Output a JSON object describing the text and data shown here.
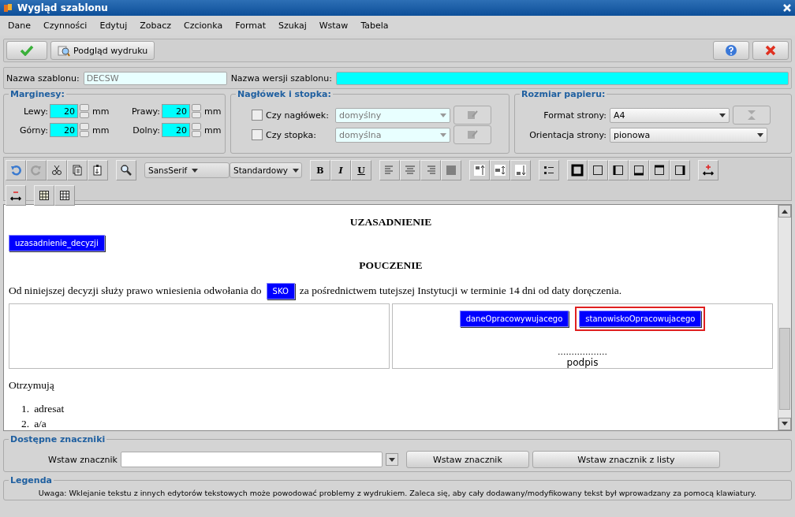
{
  "window": {
    "title": "Wygląd szablonu"
  },
  "menu": [
    "Dane",
    "Czynności",
    "Edytuj",
    "Zobacz",
    "Czcionka",
    "Format",
    "Szukaj",
    "Wstaw",
    "Tabela"
  ],
  "toolbar": {
    "preview_button": "Podgląd wydruku"
  },
  "name_row": {
    "template_label": "Nazwa szablonu:",
    "template_value": "DECSW",
    "version_label": "Nazwa wersji szablonu:"
  },
  "margins": {
    "title": "Marginesy:",
    "fields": [
      {
        "label": "Lewy:",
        "value": "20",
        "unit": "mm"
      },
      {
        "label": "Prawy:",
        "value": "20",
        "unit": "mm"
      },
      {
        "label": "Górny:",
        "value": "20",
        "unit": "mm"
      },
      {
        "label": "Dolny:",
        "value": "20",
        "unit": "mm"
      }
    ]
  },
  "header_footer": {
    "title": "Nagłówek i stopka:",
    "rows": [
      {
        "label": "Czy nagłówek:",
        "checked": false,
        "value": "domyślny"
      },
      {
        "label": "Czy stopka:",
        "checked": false,
        "value": "domyślna"
      }
    ]
  },
  "paper": {
    "title": "Rozmiar papieru:",
    "rows": [
      {
        "label": "Format strony:",
        "value": "A4"
      },
      {
        "label": "Orientacja strony:",
        "value": "pionowa"
      }
    ]
  },
  "editor_toolbar": [
    {
      "kind": "icon",
      "disabled": false
    },
    {
      "kind": "icon",
      "disabled": true
    },
    {
      "kind": "icon",
      "disabled": false
    },
    {
      "kind": "icon",
      "disabled": false
    },
    {
      "kind": "icon",
      "disabled": false
    },
    {
      "kind": "gap"
    },
    {
      "kind": "icon",
      "disabled": false
    },
    {
      "kind": "gap"
    },
    {
      "kind": "dropdown",
      "value": "SansSerif"
    },
    {
      "kind": "dropdown",
      "value": "Standardowy"
    },
    {
      "kind": "gap"
    },
    {
      "kind": "text",
      "label": "B"
    },
    {
      "kind": "text",
      "label": "I"
    },
    {
      "kind": "text",
      "label": "U"
    },
    {
      "kind": "gap"
    },
    {
      "kind": "icon",
      "disabled": false
    },
    {
      "kind": "icon",
      "disabled": false
    },
    {
      "kind": "icon",
      "disabled": false
    },
    {
      "kind": "icon",
      "disabled": false
    },
    {
      "kind": "gap"
    },
    {
      "kind": "icon",
      "disabled": false
    },
    {
      "kind": "icon",
      "disabled": false
    },
    {
      "kind": "icon",
      "disabled": false
    },
    {
      "kind": "gap"
    },
    {
      "kind": "icon",
      "disabled": false
    },
    {
      "kind": "gap"
    },
    {
      "kind": "icon",
      "disabled": false
    },
    {
      "kind": "icon",
      "disabled": false
    },
    {
      "kind": "icon",
      "disabled": false
    },
    {
      "kind": "icon",
      "disabled": false
    },
    {
      "kind": "icon",
      "disabled": false
    },
    {
      "kind": "icon",
      "disabled": false
    },
    {
      "kind": "gap"
    },
    {
      "kind": "icon",
      "disabled": false
    },
    {
      "kind": "break"
    },
    {
      "kind": "icon",
      "disabled": false
    },
    {
      "kind": "gap"
    },
    {
      "kind": "icon",
      "disabled": false
    },
    {
      "kind": "icon",
      "disabled": false
    }
  ],
  "document": [
    {
      "kind": "heading",
      "text": "UZASADNIENIE"
    },
    {
      "kind": "tag",
      "text": "uzasadnienie_decyzji",
      "highlighted": false
    },
    {
      "kind": "heading",
      "text": "POUCZENIE"
    },
    {
      "kind": "paragraph",
      "parts": [
        {
          "kind": "text",
          "text": "Od niniejszej decyzji służy prawo wniesienia odwołania do"
        },
        {
          "kind": "tag",
          "text": "SKO",
          "highlighted": false
        },
        {
          "kind": "text",
          "text": "za pośrednictwem tutejszej Instytucji w terminie 14 dni od daty doręczenia."
        }
      ]
    },
    {
      "kind": "signature_table",
      "tags": [
        {
          "text": "daneOpracowywujacego",
          "highlighted": false
        },
        {
          "text": "stanowiskoOpracowujacego",
          "highlighted": true
        }
      ],
      "dots": "..................",
      "caption": "podpis"
    },
    {
      "kind": "text",
      "text": "Otrzymują"
    },
    {
      "kind": "list",
      "items": [
        {
          "number": "1.",
          "text": "adresat"
        },
        {
          "number": "2.",
          "text": "a/a"
        }
      ]
    }
  ],
  "markers": {
    "title": "Dostępne znaczniki",
    "label": "Wstaw znacznik",
    "insert_button": "Wstaw znacznik",
    "insert_list_button": "Wstaw znacznik z listy"
  },
  "legend": {
    "title": "Legenda",
    "text": "Uwaga: Wklejanie tekstu z innych edytorów tekstowych może powodować problemy z wydrukiem. Zaleca się, aby cały dodawany/modyfikowany tekst był wprowadzany za pomocą klawiatury."
  }
}
